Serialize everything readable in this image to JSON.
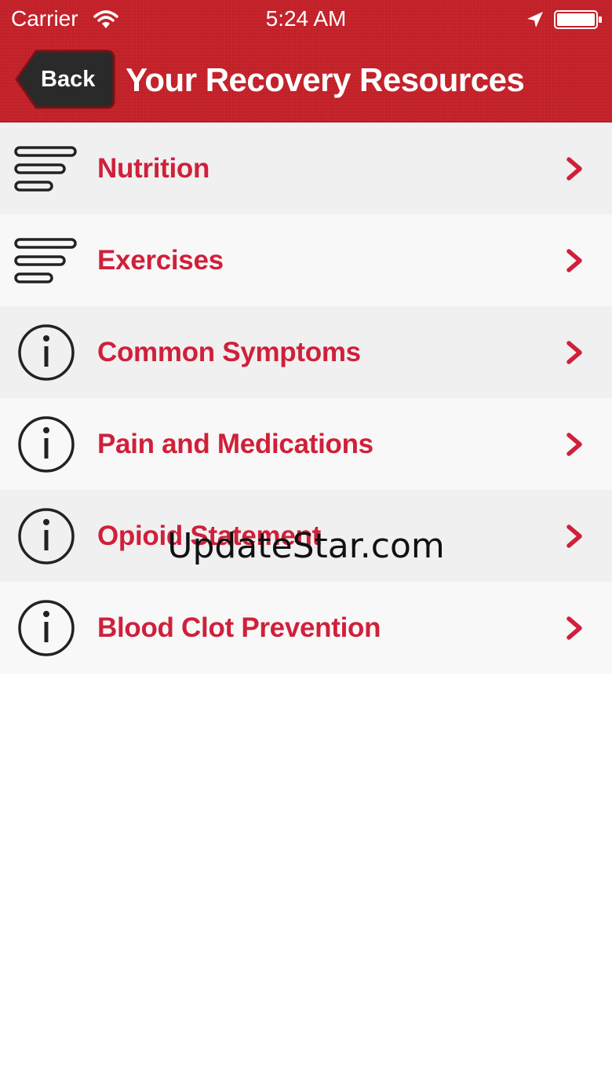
{
  "status_bar": {
    "carrier": "Carrier",
    "time": "5:24 AM",
    "icons": [
      "wifi-icon",
      "location-arrow-icon",
      "battery-icon"
    ]
  },
  "nav_bar": {
    "back_label": "Back",
    "title": "Your Recovery Resources"
  },
  "resources": [
    {
      "label": "Nutrition",
      "icon": "text-lines-icon"
    },
    {
      "label": "Exercises",
      "icon": "text-lines-icon"
    },
    {
      "label": "Common Symptoms",
      "icon": "info-icon"
    },
    {
      "label": "Pain and Medications",
      "icon": "info-icon"
    },
    {
      "label": "Opioid Statement",
      "icon": "info-icon"
    },
    {
      "label": "Blood Clot Prevention",
      "icon": "info-icon"
    }
  ],
  "watermark": "UpdateStar.com",
  "colors": {
    "header_red": "#c8242c",
    "label_red": "#d0203a",
    "back_button_dark": "#2a2a2a",
    "row_shade_a": "#f0f0f0",
    "row_shade_b": "#f8f8f8"
  }
}
